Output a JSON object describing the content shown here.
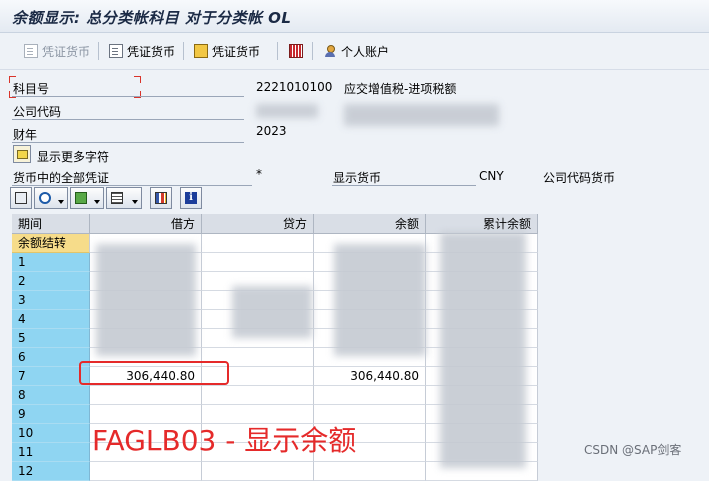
{
  "window": {
    "title": "余额显示: 总分类帐科目 对于分类帐 OL"
  },
  "toolbar": {
    "items": [
      {
        "label": "凭证货币",
        "icon": "document-icon",
        "enabled": false
      },
      {
        "label": "凭证货币",
        "icon": "document-icon",
        "enabled": true
      },
      {
        "label": "凭证货币",
        "icon": "hierarchy-icon",
        "enabled": true
      },
      {
        "label": "",
        "icon": "bar-grid-icon",
        "enabled": true
      },
      {
        "label": "个人账户",
        "icon": "person-icon",
        "enabled": true
      }
    ]
  },
  "form": {
    "account_label": "科目号",
    "account_value": "2221010100",
    "account_desc": "应交增值税-进项税额",
    "company_label": "公司代码",
    "year_label": "财年",
    "year_value": "2023",
    "more_fields_label": "显示更多字符",
    "all_docs_label": "货币中的全部凭证",
    "all_docs_value": "*",
    "display_currency_label": "显示货币",
    "display_currency_value": "CNY",
    "company_currency_label": "公司代码货币"
  },
  "grid_toolbar": {
    "buttons": [
      "print-icon",
      "find-icon",
      "export-icon",
      "layout-icon",
      "chart-icon",
      "info-icon"
    ]
  },
  "table": {
    "columns": [
      "期间",
      "借方",
      "贷方",
      "余额",
      "累计余额"
    ],
    "rows": [
      {
        "period": "余额结转",
        "debit": "",
        "credit": "",
        "balance": "",
        "cumulative": ""
      },
      {
        "period": "1",
        "debit": "",
        "credit": "",
        "balance": "",
        "cumulative": ""
      },
      {
        "period": "2",
        "debit": "",
        "credit": "",
        "balance": "",
        "cumulative": ""
      },
      {
        "period": "3",
        "debit": "",
        "credit": "",
        "balance": "",
        "cumulative": ""
      },
      {
        "period": "4",
        "debit": "",
        "credit": "",
        "balance": "",
        "cumulative": ""
      },
      {
        "period": "5",
        "debit": "",
        "credit": "",
        "balance": "",
        "cumulative": ""
      },
      {
        "period": "6",
        "debit": "",
        "credit": "",
        "balance": "",
        "cumulative": ""
      },
      {
        "period": "7",
        "debit": "306,440.80",
        "credit": "",
        "balance": "306,440.80",
        "cumulative": ""
      },
      {
        "period": "8",
        "debit": "",
        "credit": "",
        "balance": "",
        "cumulative": ""
      },
      {
        "period": "9",
        "debit": "",
        "credit": "",
        "balance": "",
        "cumulative": ""
      },
      {
        "period": "10",
        "debit": "",
        "credit": "",
        "balance": "",
        "cumulative": ""
      },
      {
        "period": "11",
        "debit": "",
        "credit": "",
        "balance": "",
        "cumulative": ""
      },
      {
        "period": "12",
        "debit": "",
        "credit": "",
        "balance": "",
        "cumulative": ""
      }
    ]
  },
  "annotation": {
    "caption": "FAGLB03 - 显示余额"
  },
  "watermark": "CSDN @SAP剑客"
}
